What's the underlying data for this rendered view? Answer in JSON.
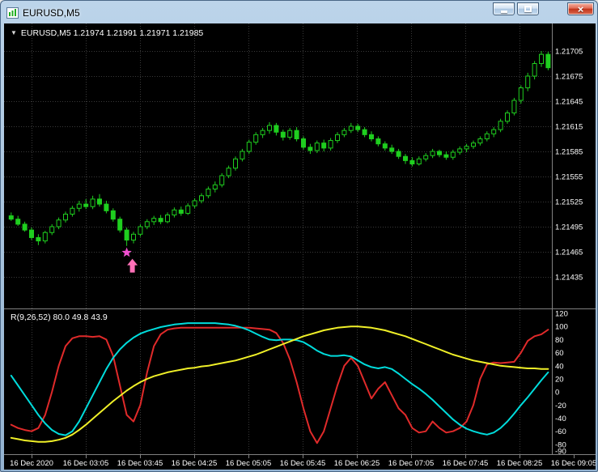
{
  "window": {
    "title": "EURUSD,M5",
    "icons": {
      "app": "chart-window-icon",
      "minimize": "minimize-icon",
      "maximize": "maximize-icon",
      "close": "close-icon",
      "symbol_marker": "triangle-down-icon"
    }
  },
  "chart": {
    "header": {
      "symbol": "EURUSD,M5",
      "open": "1.21974",
      "high": "1.21991",
      "low": "1.21971",
      "close": "1.21985",
      "text": "EURUSD,M5 1.21974 1.21991 1.21971 1.21985"
    }
  },
  "indicator": {
    "name": "R(9,26,52)",
    "values_text": "80.0 49.8 43.9",
    "text": "R(9,26,52) 80.0 49.8 43.9"
  },
  "colors": {
    "background": "#000000",
    "grid": "#3a3a3a",
    "candle_stroke": "#1fce1f",
    "bull_fill": "#000000",
    "bear_fill": "#1fce1f",
    "axis_text": "#ffffff",
    "separator": "#808080",
    "star": "#f050d0",
    "arrow": "#ff70b8"
  },
  "chart_data": {
    "type": "candlestick",
    "symbol": "EURUSD",
    "timeframe": "M5",
    "title": "EURUSD,M5",
    "x_labels": [
      "16 Dec 2020",
      "16 Dec 03:05",
      "16 Dec 03:45",
      "16 Dec 04:25",
      "16 Dec 05:05",
      "16 Dec 05:45",
      "16 Dec 06:25",
      "16 Dec 07:05",
      "16 Dec 07:45",
      "16 Dec 08:25",
      "16 Dec 09:05"
    ],
    "price_axis_ticks": [
      "1.21705",
      "1.21675",
      "1.21645",
      "1.21615",
      "1.21585",
      "1.21555",
      "1.21525",
      "1.21495",
      "1.21465",
      "1.21435"
    ],
    "candles": [
      [
        1.21508,
        1.21512,
        1.21502,
        1.21504
      ],
      [
        1.21504,
        1.21508,
        1.21496,
        1.21498
      ],
      [
        1.21498,
        1.21501,
        1.21489,
        1.21491
      ],
      [
        1.21491,
        1.21494,
        1.21479,
        1.21482
      ],
      [
        1.21482,
        1.21486,
        1.21473,
        1.21478
      ],
      [
        1.21478,
        1.2149,
        1.21475,
        1.21488
      ],
      [
        1.21488,
        1.21498,
        1.21485,
        1.21495
      ],
      [
        1.21495,
        1.21506,
        1.21492,
        1.21503
      ],
      [
        1.21503,
        1.21513,
        1.215,
        1.2151
      ],
      [
        1.2151,
        1.2152,
        1.21507,
        1.21517
      ],
      [
        1.21517,
        1.21526,
        1.21513,
        1.21522
      ],
      [
        1.21522,
        1.21528,
        1.21516,
        1.21519
      ],
      [
        1.21519,
        1.21532,
        1.21516,
        1.21528
      ],
      [
        1.21528,
        1.21534,
        1.21519,
        1.21522
      ],
      [
        1.21522,
        1.21526,
        1.21511,
        1.21514
      ],
      [
        1.21514,
        1.21517,
        1.21501,
        1.21504
      ],
      [
        1.21504,
        1.21507,
        1.21488,
        1.21491
      ],
      [
        1.21491,
        1.21494,
        1.21472,
        1.21479
      ],
      [
        1.21479,
        1.21489,
        1.21475,
        1.21486
      ],
      [
        1.21486,
        1.21498,
        1.21483,
        1.21495
      ],
      [
        1.21495,
        1.21504,
        1.21492,
        1.21501
      ],
      [
        1.21501,
        1.21508,
        1.21497,
        1.21505
      ],
      [
        1.21505,
        1.21509,
        1.21498,
        1.21501
      ],
      [
        1.21501,
        1.21512,
        1.21499,
        1.21509
      ],
      [
        1.21509,
        1.21518,
        1.21506,
        1.21515
      ],
      [
        1.21515,
        1.21519,
        1.21508,
        1.21511
      ],
      [
        1.21511,
        1.21523,
        1.21509,
        1.2152
      ],
      [
        1.2152,
        1.21529,
        1.21517,
        1.21526
      ],
      [
        1.21526,
        1.21535,
        1.21523,
        1.21532
      ],
      [
        1.21532,
        1.21543,
        1.21529,
        1.2154
      ],
      [
        1.2154,
        1.21549,
        1.21536,
        1.21545
      ],
      [
        1.21545,
        1.21559,
        1.21542,
        1.21556
      ],
      [
        1.21556,
        1.21568,
        1.21553,
        1.21565
      ],
      [
        1.21565,
        1.21579,
        1.21562,
        1.21576
      ],
      [
        1.21576,
        1.21588,
        1.21573,
        1.21585
      ],
      [
        1.21585,
        1.21599,
        1.21582,
        1.21596
      ],
      [
        1.21596,
        1.21608,
        1.21593,
        1.21605
      ],
      [
        1.21605,
        1.21613,
        1.21601,
        1.2161
      ],
      [
        1.2161,
        1.2162,
        1.21606,
        1.21616
      ],
      [
        1.21616,
        1.21619,
        1.21604,
        1.21608
      ],
      [
        1.21608,
        1.21611,
        1.21598,
        1.21602
      ],
      [
        1.21602,
        1.21613,
        1.21599,
        1.2161
      ],
      [
        1.2161,
        1.21614,
        1.21597,
        1.216
      ],
      [
        1.216,
        1.21603,
        1.21587,
        1.2159
      ],
      [
        1.2159,
        1.21594,
        1.21582,
        1.21586
      ],
      [
        1.21586,
        1.21598,
        1.21583,
        1.21595
      ],
      [
        1.21595,
        1.21599,
        1.21585,
        1.21589
      ],
      [
        1.21589,
        1.21601,
        1.21586,
        1.21598
      ],
      [
        1.21598,
        1.21608,
        1.21595,
        1.21605
      ],
      [
        1.21605,
        1.21613,
        1.21602,
        1.2161
      ],
      [
        1.2161,
        1.21619,
        1.21607,
        1.21615
      ],
      [
        1.21615,
        1.21618,
        1.21608,
        1.21611
      ],
      [
        1.21611,
        1.21614,
        1.21602,
        1.21605
      ],
      [
        1.21605,
        1.21609,
        1.21597,
        1.216
      ],
      [
        1.216,
        1.21603,
        1.21591,
        1.21594
      ],
      [
        1.21594,
        1.21597,
        1.21586,
        1.21589
      ],
      [
        1.21589,
        1.21593,
        1.21582,
        1.21585
      ],
      [
        1.21585,
        1.21588,
        1.21576,
        1.21579
      ],
      [
        1.21579,
        1.21582,
        1.2157,
        1.21574
      ],
      [
        1.21574,
        1.21578,
        1.21567,
        1.2157
      ],
      [
        1.2157,
        1.21579,
        1.21568,
        1.21576
      ],
      [
        1.21576,
        1.21583,
        1.21573,
        1.2158
      ],
      [
        1.2158,
        1.21588,
        1.21577,
        1.21585
      ],
      [
        1.21585,
        1.21587,
        1.21578,
        1.21581
      ],
      [
        1.21581,
        1.21585,
        1.21575,
        1.21578
      ],
      [
        1.21578,
        1.21587,
        1.21575,
        1.21584
      ],
      [
        1.21584,
        1.21591,
        1.21581,
        1.21588
      ],
      [
        1.21588,
        1.21594,
        1.21584,
        1.21591
      ],
      [
        1.21591,
        1.21598,
        1.21588,
        1.21595
      ],
      [
        1.21595,
        1.21603,
        1.21592,
        1.216
      ],
      [
        1.216,
        1.21609,
        1.21597,
        1.21606
      ],
      [
        1.21606,
        1.21614,
        1.21602,
        1.21611
      ],
      [
        1.21611,
        1.21624,
        1.21608,
        1.21621
      ],
      [
        1.21621,
        1.21634,
        1.21618,
        1.21631
      ],
      [
        1.21631,
        1.21649,
        1.21628,
        1.21646
      ],
      [
        1.21646,
        1.21664,
        1.21642,
        1.21661
      ],
      [
        1.21661,
        1.21679,
        1.21657,
        1.21675
      ],
      [
        1.21675,
        1.21693,
        1.21671,
        1.2169
      ],
      [
        1.2169,
        1.21705,
        1.21686,
        1.21701
      ],
      [
        1.21701,
        1.21704,
        1.21682,
        1.21685
      ]
    ],
    "signal_marker": {
      "type": "buy",
      "candle_index": 17,
      "star_price": 1.21464,
      "arrow_price": 1.21448
    },
    "indicator": {
      "name": "R(9,26,52)",
      "current_values": [
        80.0,
        49.8,
        43.9
      ],
      "scale_ticks": [
        120,
        100,
        80,
        60,
        40,
        20,
        0,
        -20,
        -40,
        -60,
        -80,
        -90
      ],
      "series": [
        {
          "name": "red-line",
          "color": "#e02a2a",
          "values": [
            -50,
            -55,
            -58,
            -60,
            -55,
            -35,
            0,
            40,
            70,
            82,
            85,
            85,
            84,
            85,
            80,
            55,
            10,
            -35,
            -45,
            -20,
            30,
            70,
            88,
            95,
            97,
            98,
            98,
            98,
            98,
            98,
            98,
            98,
            98,
            98,
            98,
            98,
            97,
            96,
            95,
            90,
            75,
            50,
            15,
            -25,
            -60,
            -78,
            -60,
            -25,
            10,
            40,
            52,
            40,
            15,
            -10,
            5,
            15,
            -5,
            -25,
            -35,
            -55,
            -62,
            -60,
            -45,
            -55,
            -62,
            -60,
            -55,
            -45,
            -20,
            20,
            42,
            45,
            44,
            45,
            46,
            60,
            78,
            85,
            88,
            95
          ]
        },
        {
          "name": "aqua-line",
          "color": "#00dcdc",
          "values": [
            25,
            10,
            -5,
            -20,
            -35,
            -48,
            -58,
            -64,
            -66,
            -60,
            -45,
            -25,
            -5,
            15,
            35,
            52,
            65,
            75,
            83,
            89,
            93,
            96,
            99,
            101,
            103,
            104,
            105,
            105,
            105,
            105,
            105,
            104,
            103,
            101,
            98,
            94,
            89,
            84,
            80,
            79,
            80,
            80,
            79,
            76,
            70,
            63,
            58,
            55,
            55,
            56,
            54,
            48,
            42,
            38,
            36,
            38,
            35,
            28,
            20,
            12,
            5,
            -3,
            -12,
            -22,
            -32,
            -42,
            -50,
            -56,
            -60,
            -63,
            -65,
            -62,
            -55,
            -45,
            -33,
            -20,
            -8,
            5,
            18,
            30
          ]
        },
        {
          "name": "yellow-line",
          "color": "#f0f028",
          "values": [
            -70,
            -72,
            -74,
            -75,
            -76,
            -76,
            -75,
            -73,
            -70,
            -65,
            -58,
            -50,
            -41,
            -32,
            -23,
            -14,
            -6,
            2,
            9,
            15,
            20,
            24,
            27,
            30,
            32,
            34,
            36,
            37,
            39,
            40,
            42,
            44,
            46,
            48,
            51,
            54,
            57,
            61,
            65,
            69,
            73,
            77,
            81,
            85,
            88,
            91,
            94,
            96,
            98,
            99,
            100,
            100,
            99,
            98,
            96,
            94,
            91,
            88,
            85,
            81,
            77,
            73,
            69,
            65,
            61,
            57,
            54,
            51,
            48,
            46,
            44,
            42,
            40,
            39,
            38,
            37,
            36,
            36,
            35,
            35
          ]
        }
      ]
    }
  }
}
